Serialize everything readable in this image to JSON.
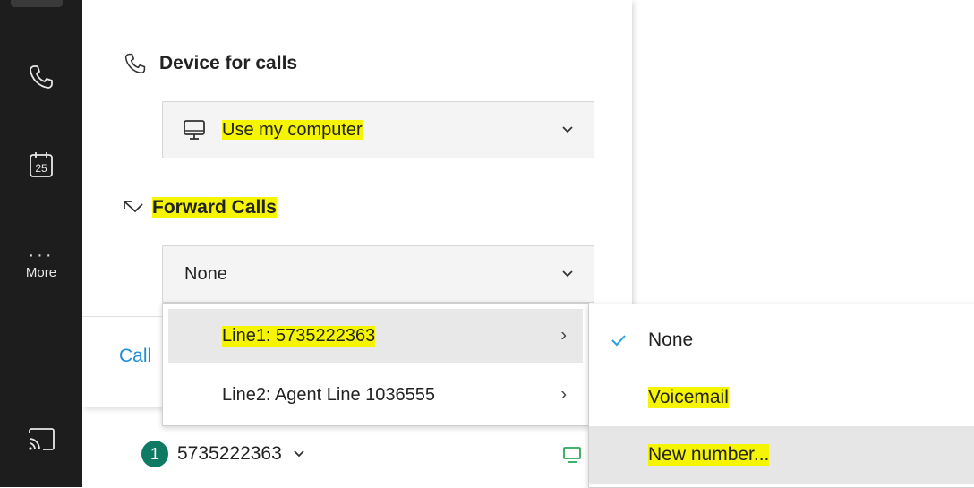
{
  "rail": {
    "more_label": "More",
    "calendar_day": "25",
    "icons": [
      "phone-icon",
      "calendar-icon",
      "more-icon",
      "cast-icon"
    ]
  },
  "device_section": {
    "title": "Device for calls",
    "selected_value": "Use my computer",
    "icon": "phone-icon"
  },
  "forward_section": {
    "title": "Forward Calls",
    "selected_value": "None",
    "icon": "forward-icon"
  },
  "call_link": "Call",
  "line_menu": {
    "items": [
      {
        "label": "Line1: 5735222363",
        "active": true
      },
      {
        "label": "Line2: Agent Line 1036555",
        "active": false
      }
    ]
  },
  "forward_submenu": {
    "items": [
      {
        "label": "None",
        "checked": true
      },
      {
        "label": "Voicemail",
        "checked": false
      },
      {
        "label": "New number...",
        "checked": false
      }
    ]
  },
  "status_bar": {
    "badge": "1",
    "line_number": "5735222363"
  },
  "colors": {
    "rail_bg": "#1d1d1d",
    "highlight": "#f5f500",
    "accent_blue": "#1f8dd6",
    "badge_green": "#0f7a63",
    "check_blue": "#2a9fe0"
  }
}
